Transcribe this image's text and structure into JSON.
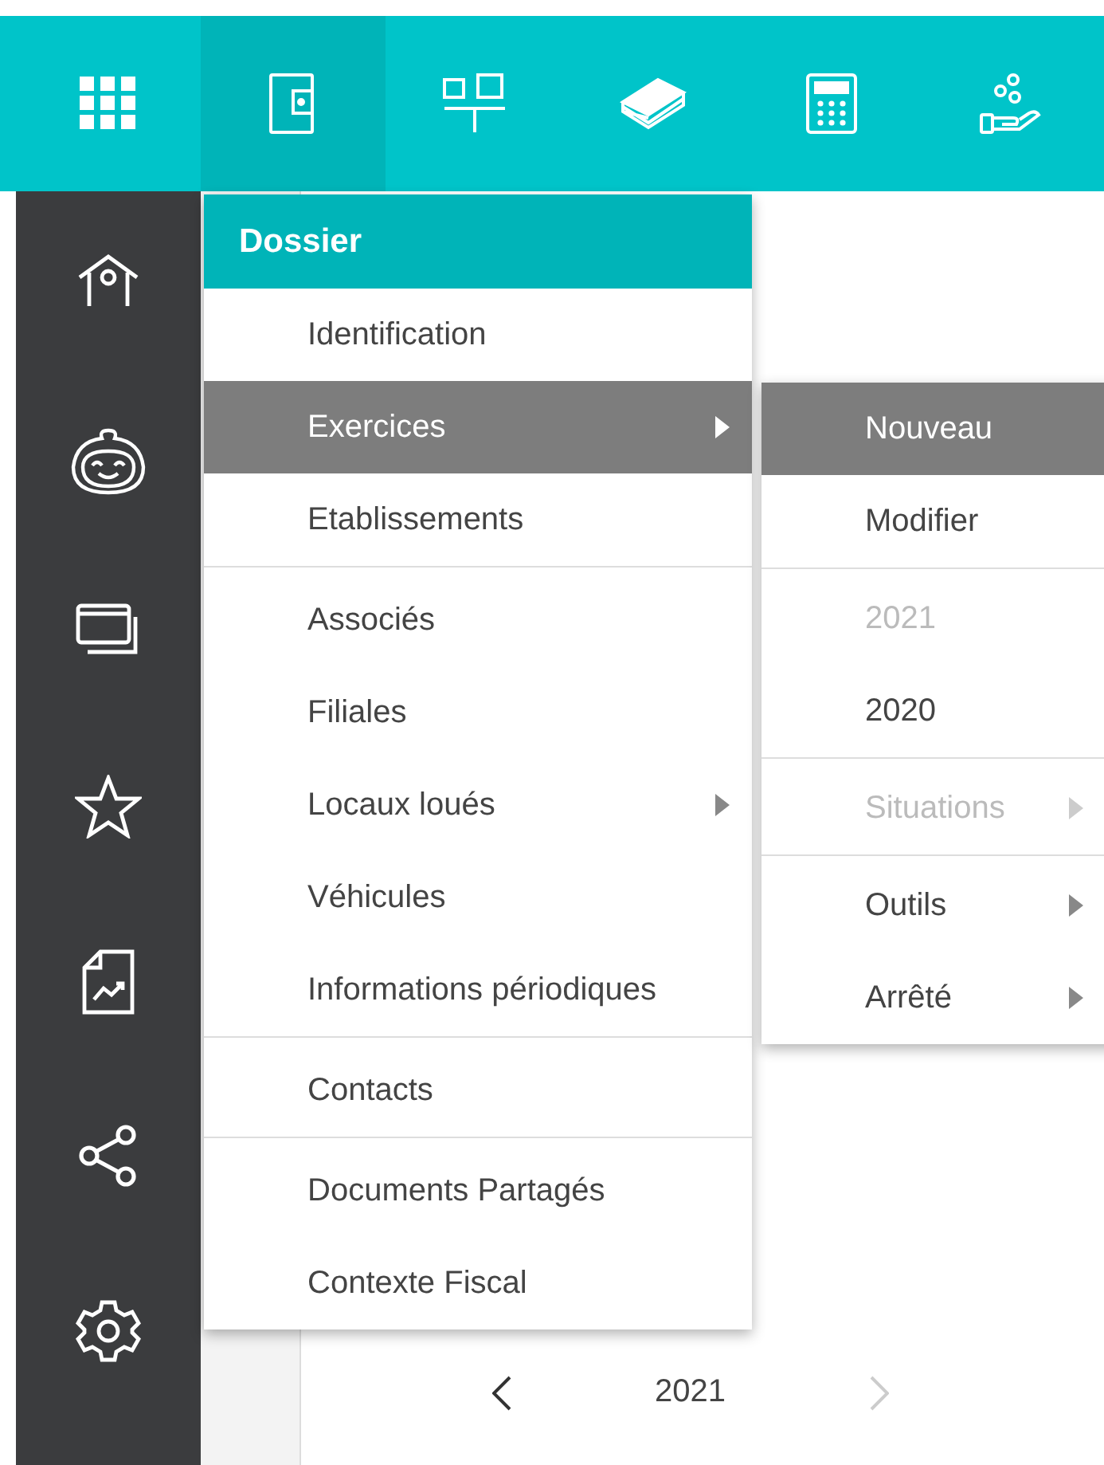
{
  "toolbar": {
    "items": [
      {
        "selected": false
      },
      {
        "selected": true
      },
      {
        "selected": false
      },
      {
        "selected": false
      },
      {
        "selected": false
      },
      {
        "selected": false
      }
    ]
  },
  "menu": {
    "title": "Dossier",
    "groups": [
      [
        {
          "label": "Identification",
          "selected": false,
          "has_submenu": false
        },
        {
          "label": "Exercices",
          "selected": true,
          "has_submenu": true
        },
        {
          "label": "Etablissements",
          "selected": false,
          "has_submenu": false
        }
      ],
      [
        {
          "label": "Associés",
          "selected": false,
          "has_submenu": false
        },
        {
          "label": "Filiales",
          "selected": false,
          "has_submenu": false
        },
        {
          "label": "Locaux loués",
          "selected": false,
          "has_submenu": true
        },
        {
          "label": "Véhicules",
          "selected": false,
          "has_submenu": false
        },
        {
          "label": "Informations périodiques",
          "selected": false,
          "has_submenu": false
        }
      ],
      [
        {
          "label": "Contacts",
          "selected": false,
          "has_submenu": false
        }
      ],
      [
        {
          "label": "Documents Partagés",
          "selected": false,
          "has_submenu": false
        },
        {
          "label": "Contexte Fiscal",
          "selected": false,
          "has_submenu": false
        }
      ]
    ]
  },
  "submenu": {
    "groups": [
      [
        {
          "label": "Nouveau",
          "selected": true,
          "disabled": false,
          "has_submenu": false
        },
        {
          "label": "Modifier",
          "selected": false,
          "disabled": false,
          "has_submenu": false
        }
      ],
      [
        {
          "label": "2021",
          "selected": false,
          "disabled": true,
          "has_submenu": false
        },
        {
          "label": "2020",
          "selected": false,
          "disabled": false,
          "has_submenu": false
        }
      ],
      [
        {
          "label": "Situations",
          "selected": false,
          "disabled": true,
          "has_submenu": true
        }
      ],
      [
        {
          "label": "Outils",
          "selected": false,
          "disabled": false,
          "has_submenu": true
        },
        {
          "label": "Arrêté",
          "selected": false,
          "disabled": false,
          "has_submenu": true
        }
      ]
    ]
  },
  "year_nav": {
    "year": "2021"
  }
}
